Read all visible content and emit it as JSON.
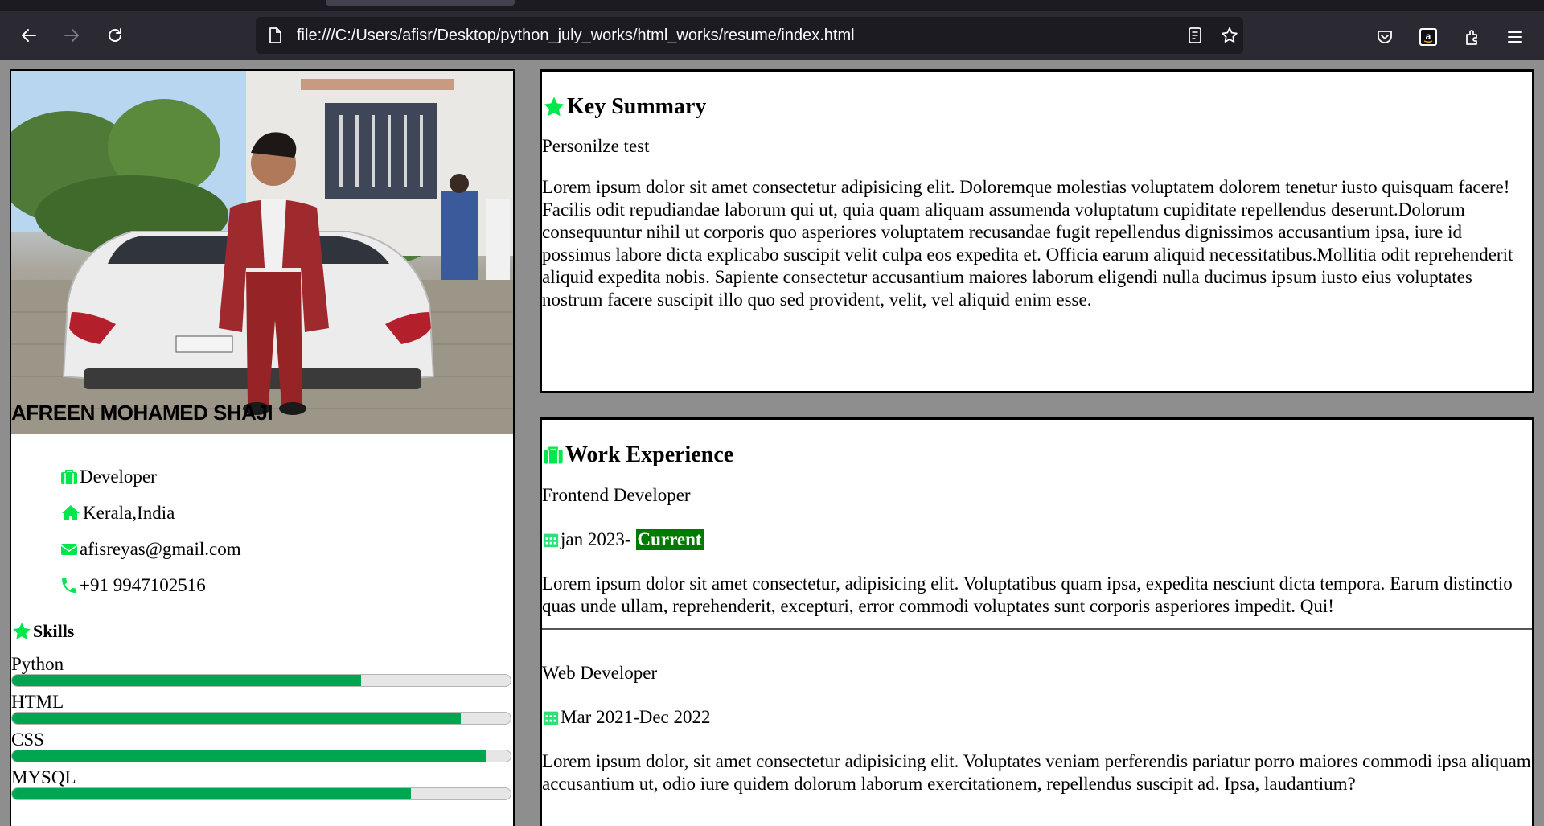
{
  "browser": {
    "url": "file:///C:/Users/afisr/Desktop/python_july_works/html_works/resume/index.html",
    "icons": [
      "back-icon",
      "forward-icon",
      "reload-icon",
      "page-icon",
      "reader-view-icon",
      "bookmark-star-icon",
      "pocket-icon",
      "amazon-icon",
      "extensions-icon",
      "menu-icon"
    ]
  },
  "profile": {
    "name": "AFREEN MOHAMED SHAJI",
    "info": [
      {
        "icon": "briefcase-icon",
        "text": "Developer"
      },
      {
        "icon": "home-icon",
        "text": "Kerala,India"
      },
      {
        "icon": "envelope-icon",
        "text": "afisreyas@gmail.com"
      },
      {
        "icon": "phone-icon",
        "text": "+91 9947102516"
      }
    ]
  },
  "skills": {
    "title": "Skills",
    "items": [
      {
        "label": "Python",
        "level": 0.7
      },
      {
        "label": "HTML",
        "level": 0.9
      },
      {
        "label": "CSS",
        "level": 0.95
      },
      {
        "label": "MYSQL",
        "level": 0.8
      }
    ]
  },
  "summary": {
    "title": "Key Summary",
    "subtitle": "Personilze test",
    "body": "Lorem ipsum dolor sit amet consectetur adipisicing elit. Doloremque molestias voluptatem dolorem tenetur iusto quisquam facere! Facilis odit repudiandae laborum qui ut, quia quam aliquam assumenda voluptatum cupiditate repellendus deserunt.Dolorum consequuntur nihil ut corporis quo asperiores voluptatem recusandae fugit repellendus dignissimos accusantium ipsa, iure id possimus labore dicta explicabo suscipit velit culpa eos expedita et. Officia earum aliquid necessitatibus.Mollitia odit reprehenderit aliquid expedita nobis. Sapiente consectetur accusantium maiores laborum eligendi nulla ducimus ipsum iusto eius voluptates nostrum facere suscipit illo quo sed provident, velit, vel aliquid enim esse."
  },
  "work": {
    "title": "Work Experience",
    "jobs": [
      {
        "title": "Frontend Developer",
        "date": "jan 2023- ",
        "badge": "Current",
        "body": "Lorem ipsum dolor sit amet consectetur, adipisicing elit. Voluptatibus quam ipsa, expedita nesciunt dicta tempora. Earum distinctio quas unde ullam, reprehenderit, excepturi, error commodi voluptates sunt corporis asperiores impedit. Qui!"
      },
      {
        "title": "Web Developer",
        "date": "Mar 2021-Dec 2022",
        "body": "Lorem ipsum dolor, sit amet consectetur adipisicing elit. Voluptates veniam perferendis pariatur porro maiores commodi ipsa aliquam accusantium ut, odio iure quidem dolorum laborum exercitationem, repellendus suscipit ad. Ipsa, laudantium?"
      }
    ]
  },
  "colors": {
    "icon_green": "#00e64d",
    "bar_fill": "#00a54f",
    "badge_bg": "#007b00",
    "toolbar_bg": "#2b2a33",
    "urlbar_bg": "#1c1b22"
  }
}
